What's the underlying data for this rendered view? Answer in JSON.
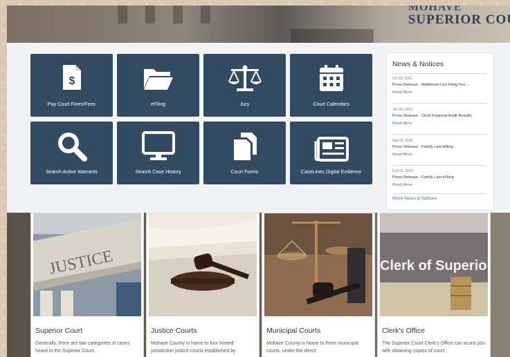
{
  "hero": {
    "line1": "MOHAVE",
    "line2": "SUPERIOR COU"
  },
  "tiles": [
    {
      "label": "Pay Court Fines/Fees",
      "icon": "document-dollar-icon"
    },
    {
      "label": "eFiling",
      "icon": "folder-open-icon"
    },
    {
      "label": "Jury",
      "icon": "scales-icon"
    },
    {
      "label": "Court Calendars",
      "icon": "calendar-icon"
    },
    {
      "label": "Search Active Warrants",
      "icon": "search-icon"
    },
    {
      "label": "Search Case History",
      "icon": "monitor-icon"
    },
    {
      "label": "Court Forms",
      "icon": "copy-documents-icon"
    },
    {
      "label": "CaseLines Digital Evidence",
      "icon": "newspaper-icon"
    }
  ],
  "news": {
    "heading": "News & Notices",
    "items": [
      {
        "date": "Oct 18, 2022",
        "title": "Press Release - Additional Civil Filing Fee...",
        "more": "Read More"
      },
      {
        "date": "Jun 06, 2022",
        "title": "Press Release - Clerk Financial Audit Results",
        "more": "Read More"
      },
      {
        "date": "Mar 02, 2022",
        "title": "Press Release - Family Law Efiling",
        "more": "Read More"
      },
      {
        "date": "Feb 03, 2022",
        "title": "Press Release - Family Law eFiling",
        "more": "Read More"
      }
    ],
    "all_link": "More News & Notices"
  },
  "cards": [
    {
      "title": "Superior Court",
      "text": "Generally, there are two categories of cases heard in the Superior Court:",
      "image_text": "JUSTICE"
    },
    {
      "title": "Justice Courts",
      "text": "Mohave County is home to four limited jurisdiction justice courts established by",
      "image_text": ""
    },
    {
      "title": "Municipal Courts",
      "text": "Mohave County is home to three municipal courts, under the direct",
      "image_text": ""
    },
    {
      "title": "Clerk's Office",
      "text": "The Superior Court Clerk's Office can assist you with obtaining copies of court",
      "image_text": "Clerk of Superior Court"
    }
  ]
}
